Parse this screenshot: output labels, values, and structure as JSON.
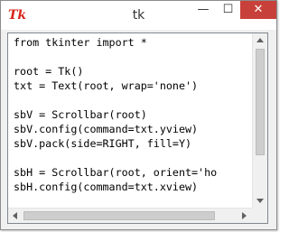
{
  "window": {
    "title": "tk",
    "icon_label": "Tk",
    "controls": {
      "minimize": "—",
      "maximize": "☐",
      "close": "✕"
    }
  },
  "editor": {
    "lines": [
      "from tkinter import *",
      "",
      "root = Tk()",
      "txt = Text(root, wrap='none')",
      "",
      "sbV = Scrollbar(root)",
      "sbV.config(command=txt.yview)",
      "sbV.pack(side=RIGHT, fill=Y)",
      "",
      "sbH = Scrollbar(root, orient='ho",
      "sbH.config(command=txt.xview)"
    ]
  }
}
